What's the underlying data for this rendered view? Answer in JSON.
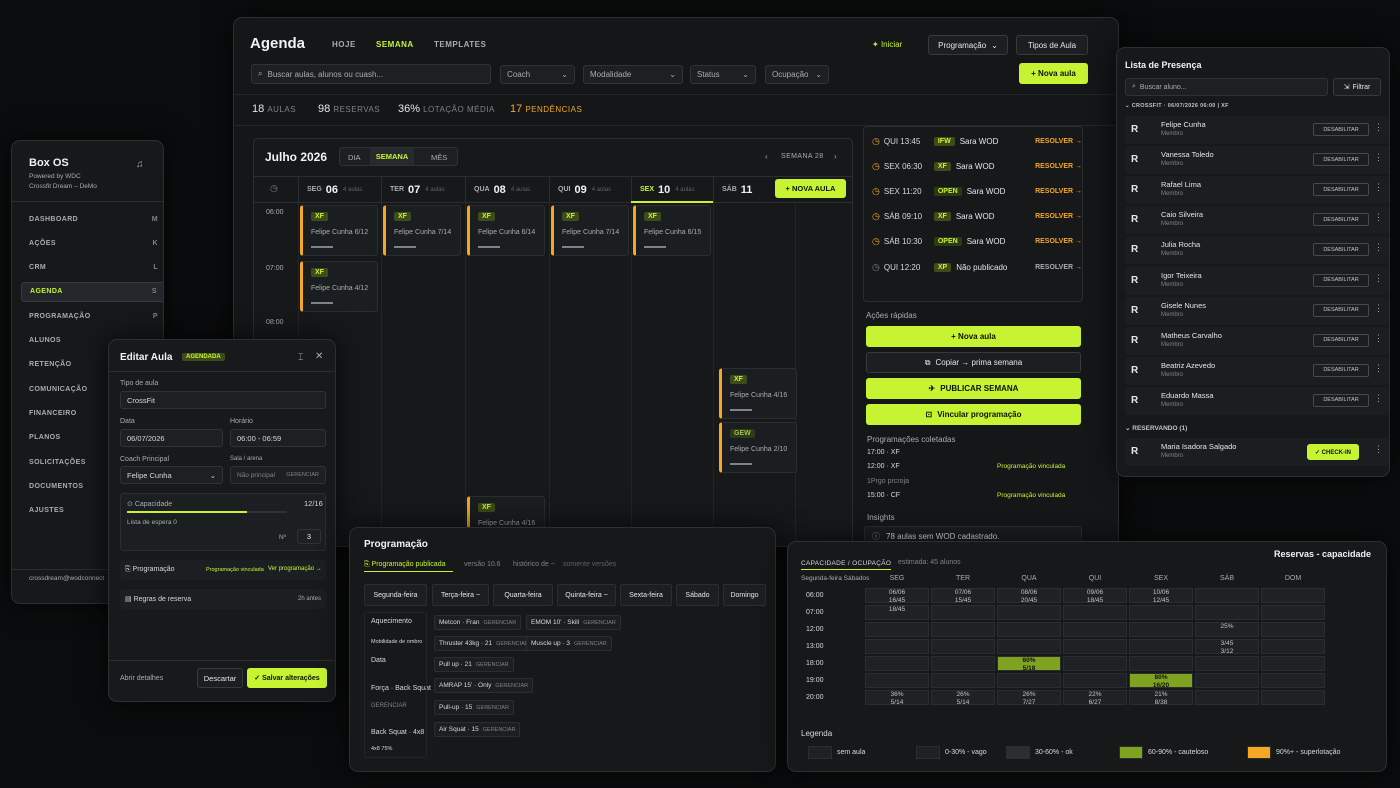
{
  "sidebar": {
    "title": "Box OS",
    "powered": "Powered by WDC",
    "tenant": "Crossfit Dream – DeMo",
    "items": [
      {
        "label": "DASHBOARD",
        "key": "M"
      },
      {
        "label": "AÇÕES",
        "key": "K"
      },
      {
        "label": "CRM",
        "key": "L"
      },
      {
        "label": "AGENDA",
        "key": "S"
      },
      {
        "label": "PROGRAMAÇÃO",
        "key": "P"
      },
      {
        "label": "ALUNOS",
        "key": ""
      },
      {
        "label": "RETENÇÃO",
        "key": ""
      },
      {
        "label": "COMUNICAÇÃO",
        "key": ""
      },
      {
        "label": "FINANCEIRO",
        "key": ""
      },
      {
        "label": "PLANOS",
        "key": ""
      },
      {
        "label": "SOLICITAÇÕES",
        "key": ""
      },
      {
        "label": "DOCUMENTOS",
        "key": ""
      },
      {
        "label": "AJUSTES",
        "key": ""
      }
    ],
    "footer": "crossdream@wodconnect"
  },
  "agenda": {
    "title": "Agenda",
    "tabs": [
      "HOJE",
      "SEMANA",
      "TEMPLATES"
    ],
    "iniciar": "Iniciar",
    "programacao_btn": "Programação",
    "tipos_btn": "Tipos de Aula",
    "search_placeholder": "Buscar aulas, alunos ou cuash...",
    "filters": [
      "Coach",
      "Modalidade",
      "Status",
      "Ocupação"
    ],
    "nova_aula": "+ Nova aula",
    "stats": [
      {
        "num": "18",
        "label": "AULAS"
      },
      {
        "num": "98",
        "label": "RESERVAS"
      },
      {
        "num": "36%",
        "label": "LOTAÇÃO MÉDIA"
      },
      {
        "num": "17",
        "label": "PENDÊNCIAS"
      }
    ],
    "month": "Julho 2026",
    "views": [
      "DIA",
      "SEMANA",
      "MÊS"
    ],
    "week_label": "SEMANA 28",
    "nova_aula_small": "+ NOVA AULA",
    "days": [
      {
        "d": "SEG",
        "n": "06",
        "s": "4 aulas"
      },
      {
        "d": "TER",
        "n": "07",
        "s": "4 aulas"
      },
      {
        "d": "QUA",
        "n": "08",
        "s": "4 aulas"
      },
      {
        "d": "QUI",
        "n": "09",
        "s": "4 aulas"
      },
      {
        "d": "SEX",
        "n": "10",
        "s": "4 aulas"
      },
      {
        "d": "SÁB",
        "n": "11",
        "s": ""
      }
    ],
    "times": [
      "06:00",
      "07:00",
      "08:00"
    ],
    "cards": [
      {
        "tag": "XF",
        "coach": "Felipe Cunha  6/12"
      },
      {
        "tag": "XF",
        "coach": "Felipe Cunha  7/14"
      },
      {
        "tag": "XF",
        "coach": "Felipe Cunha  6/14"
      },
      {
        "tag": "XF",
        "coach": "Felipe Cunha  7/14"
      },
      {
        "tag": "XF",
        "coach": "Felipe Cunha  6/15"
      },
      {
        "tag": "XF",
        "coach": "Felipe Cunha  4/12"
      },
      {
        "tag": "XF",
        "coach": "Felipe Cunha  4/16"
      },
      {
        "tag": "GEW",
        "coach": "Felipe Cunha  2/10"
      },
      {
        "tag": "XF",
        "coach": "Felipe Cunha  4/16"
      }
    ],
    "pendencias": [
      {
        "t": "QUI 13:45",
        "tag": "IFW",
        "n": "Sara WOD",
        "r": "RESOLVER →",
        "amber": true
      },
      {
        "t": "SEX 06:30",
        "tag": "XF",
        "n": "Sara WOD",
        "r": "RESOLVER →",
        "amber": true
      },
      {
        "t": "SEX 11:20",
        "tag": "OPEN",
        "n": "Sara WOD",
        "r": "RESOLVER →",
        "amber": true
      },
      {
        "t": "SÁB 09:10",
        "tag": "XF",
        "n": "Sara WOD",
        "r": "RESOLVER →",
        "amber": true
      },
      {
        "t": "SÁB 10:30",
        "tag": "OPEN",
        "n": "Sara WOD",
        "r": "RESOLVER →",
        "amber": true
      },
      {
        "t": "QUI 12:20",
        "tag": "XP",
        "n": "Não publicado",
        "r": "RESOLVER →",
        "amber": false
      }
    ],
    "acoes_title": "Ações rápidas",
    "acoes": [
      "+ Nova aula",
      "Copiar → prima semana",
      "PUBLICAR SEMANA",
      "Vincular programação"
    ],
    "prog_coletadas": "Programações coletadas",
    "prog_list": [
      {
        "t": "17:00 · XF",
        "v": ""
      },
      {
        "t": "12:00 · XF",
        "v": "Programação vinculada"
      },
      {
        "t": "1Prgo prcroja",
        "v": ""
      },
      {
        "t": "15:00 · CF",
        "v": "Programação vinculada"
      }
    ],
    "insights_title": "Insights",
    "insight": "78 aulas sem WOD cadastrado."
  },
  "presenca": {
    "title": "Lista de Presença",
    "search_placeholder": "Buscar aluno...",
    "filtrar": "Filtrar",
    "section": "CROSSFIT · 06/07/2026 06:00 | XF",
    "members": [
      "Felipe Cunha",
      "Vanessa Toledo",
      "Rafael Lima",
      "Caio Silveira",
      "Julia Rocha",
      "Igor Teixeira",
      "Gisele Nunes",
      "Matheus Carvalho",
      "Beatriz Azevedo",
      "Eduardo Massa"
    ],
    "role": "Membro",
    "desabilitar": "DESABILITAR",
    "reservando": "RESERVANDO (1)",
    "reserved": "Maria Isadora Salgado",
    "checkin": "✓ CHECK-IN"
  },
  "editar": {
    "title": "Editar Aula",
    "badge": "AGENDADA",
    "tipo_label": "Tipo de aula",
    "tipo": "CrossFit",
    "data_label": "Data",
    "data": "06/07/2026",
    "horario_label": "Horário",
    "horario": "06:00 - 06:59",
    "coach_label": "Coach Principal",
    "coach": "Felipe Cunha",
    "sala_label": "Sala / arena",
    "sala": "Não principal",
    "gerenciar": "GERENCIAR",
    "capacidade_label": "Capacidade",
    "capacidade": "12/16",
    "lista": "Lista de espera 0",
    "stepper_label": "Nº",
    "stepper": "3",
    "programacao": "Programação",
    "prog_vinc": "Programação vinculada",
    "ver_prog": "Ver programação →",
    "regras": "Regras de reserva",
    "regras_time": "2h antes",
    "abrir": "Abrir detalhes",
    "descartar": "Descartar",
    "salvar": "✓ Salvar alterações"
  },
  "programacao": {
    "title": "Programação",
    "tabs": [
      "Programação publicada",
      "versão 10.6",
      "histórico de ~",
      "somente versões"
    ],
    "days": [
      "Segunda-feira",
      "Terça-feira ~",
      "Quarta-feira",
      "Quinta-feira ~",
      "Sexta-feira",
      "Sábado",
      "Domingo"
    ],
    "seg_items": [
      "Aquecimento",
      "Mobilidade de ombro",
      "Data",
      "Força · Back Squat",
      "GERENCIAR",
      "Back Squat · 4x8",
      "4x8 75%"
    ],
    "ter_items": [
      "Metcon · Fran",
      "Thruster 43kg · 21",
      "Pull up · 21",
      "AMRAP 15' · Only",
      "Pull-up · 15",
      "Air Squat · 15"
    ],
    "qua_items": [
      "EMOM 10' · Skill",
      "Muscle up · 3"
    ],
    "gerenciar": "GERENCIAR"
  },
  "reservas": {
    "title": "Reservas - capacidade",
    "tabs": [
      "CAPACIDADE / OCUPAÇÃO",
      "estimada: 45 alunos"
    ],
    "subtitle": "Segunda-feira Sábados",
    "days": [
      "SEG",
      "TER",
      "QUA",
      "QUI",
      "SEX",
      "SÁB",
      "DOM"
    ],
    "times": [
      "06:00",
      "07:00",
      "12:00",
      "13:00",
      "18:00",
      "19:00",
      "20:00"
    ],
    "cells": [
      {
        "r": 0,
        "c": 0,
        "t": "06/06\n16/45"
      },
      {
        "r": 0,
        "c": 1,
        "t": "07/06\n15/45"
      },
      {
        "r": 0,
        "c": 2,
        "t": "08/06\n20/45"
      },
      {
        "r": 0,
        "c": 3,
        "t": "09/06\n18/45"
      },
      {
        "r": 0,
        "c": 4,
        "t": "10/06\n12/45"
      },
      {
        "r": 1,
        "c": 0,
        "t": "18/45"
      },
      {
        "r": 2,
        "c": 5,
        "t": "25%"
      },
      {
        "r": 3,
        "c": 5,
        "t": "3/45\n3/12"
      },
      {
        "r": 4,
        "c": 2,
        "t": "60%\n5/18",
        "hi": "lime"
      },
      {
        "r": 5,
        "c": 4,
        "t": "80%\n16/20",
        "hi": "lime"
      },
      {
        "r": 6,
        "c": 0,
        "t": "36%\n5/14"
      },
      {
        "r": 6,
        "c": 1,
        "t": "26%\n5/14"
      },
      {
        "r": 6,
        "c": 2,
        "t": "26%\n7/27"
      },
      {
        "r": 6,
        "c": 3,
        "t": "22%\n6/27"
      },
      {
        "r": 6,
        "c": 4,
        "t": "21%\n8/38"
      }
    ],
    "legend_title": "Legenda",
    "legend": [
      "sem aula",
      "0-30% - vago",
      "30-60% - ok",
      "60-90% - cauteloso",
      "90%+ - superlotação"
    ],
    "legend_colors": [
      "#1f2224",
      "#1f2224",
      "#2b2f32",
      "#7fa321",
      "#f5a623"
    ]
  }
}
